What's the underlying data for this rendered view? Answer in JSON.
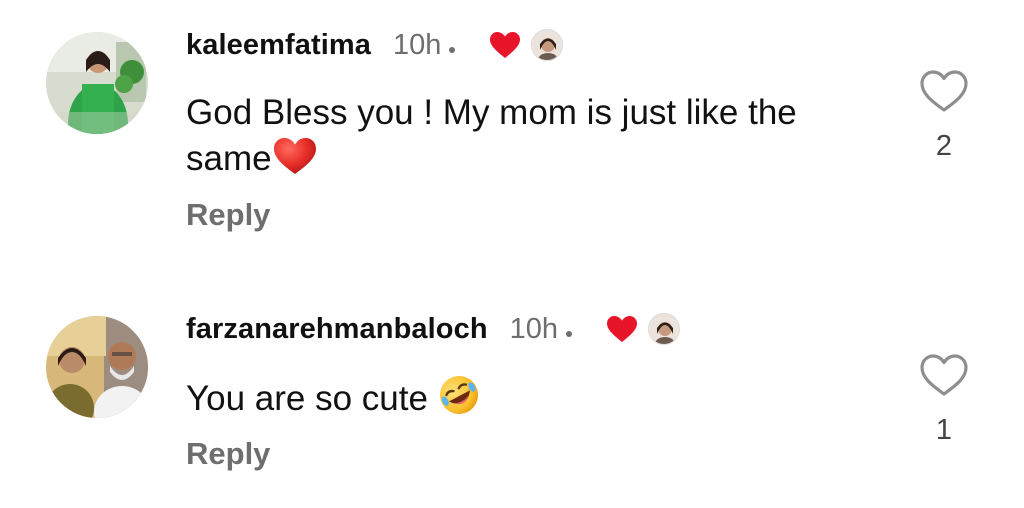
{
  "colors": {
    "heart_red": "#e8142a",
    "secondary_text": "#6e6e6e",
    "primary_text": "#111111"
  },
  "comments": [
    {
      "username": "kaleemfatima",
      "time": "10h",
      "text": "God Bless you ! My mom is just like the same",
      "text_emoji": "red-heart-emoji",
      "reply_label": "Reply",
      "like_count": "2",
      "liked_by_author": true,
      "avatar_icon": "avatar-woman-green-dress"
    },
    {
      "username": "farzanarehmanbaloch",
      "time": "10h",
      "text": "You are so cute",
      "text_emoji": "rolling-on-floor-laughing-emoji",
      "reply_label": "Reply",
      "like_count": "1",
      "liked_by_author": true,
      "avatar_icon": "avatar-couple-photo"
    }
  ]
}
